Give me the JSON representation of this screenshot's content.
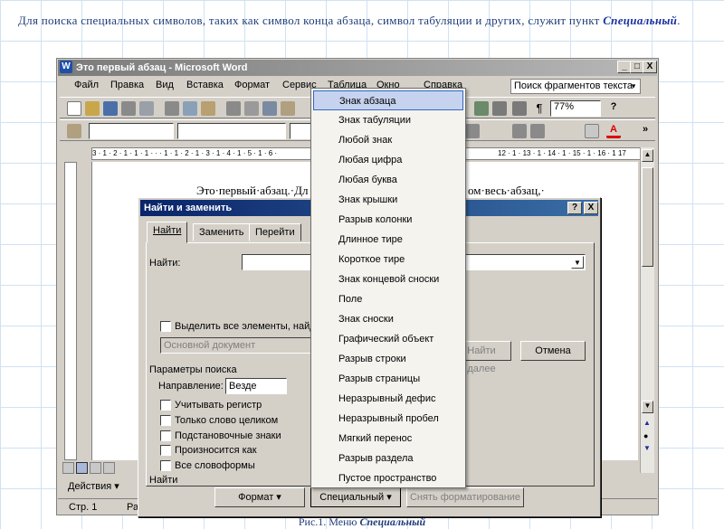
{
  "intro_text": "Для поиска специальных символов, таких как символ конца абзаца, символ табуляции и других, служит пункт",
  "intro_highlight": "Специальный",
  "intro_end": ".",
  "caption_prefix": "Рис.1. Меню",
  "caption_highlight": "Специальный",
  "window": {
    "title": "Это первый абзац - Microsoft Word",
    "app_icon": "W",
    "min_glyph": "_",
    "max_glyph": "□",
    "close_glyph": "X"
  },
  "menubar": {
    "items": [
      "Файл",
      "Правка",
      "Вид",
      "Вставка",
      "Формат",
      "Сервис",
      "Таблица",
      "Окно",
      "Справка"
    ],
    "search_text": "Поиск фрагментов текста",
    "dropdown_glyph": "▾"
  },
  "toolbar": {
    "zoom": "77%",
    "question": "?",
    "expand": "»"
  },
  "ruler_text": "3 · 1 · 2 · 1 · 1 · 1 · · · 1 · 1 · 2 · 1 · 3 · 1 · 4 · 1 · 5 · 1 · 6 ·",
  "ruler_right_text": "12 · 1 · 13 · 1 · 14 · 1 · 15 · 1 · 16 · 1 17",
  "doc_text_left": "Это·первый·абзац.·Дл",
  "doc_text_right": "ом·весь·абзац,·",
  "status": {
    "page": "Стр. 1",
    "section": "Ра",
    "actions": "Действия ▾"
  },
  "dialog": {
    "title": "Найти и заменить",
    "help_glyph": "?",
    "close_glyph": "X",
    "tabs": [
      "Найти",
      "Заменить",
      "Перейти"
    ],
    "find_label": "Найти:",
    "find_value": "",
    "highlight_label": "Выделить все элементы, найде",
    "main_doc": "Основной документ",
    "find_next": "Найти далее",
    "cancel": "Отмена",
    "search_params": "Параметры поиска",
    "direction_label": "Направление:",
    "direction_value": "Везде",
    "options": [
      "Учитывать регистр",
      "Только слово целиком",
      "Подстановочные знаки",
      "Произносится как",
      "Все словоформы"
    ],
    "find_group": "Найти",
    "format_btn": "Формат ▾",
    "special_btn": "Специальный ▾",
    "clear_format_btn": "Снять форматирование"
  },
  "special_menu": {
    "items": [
      "Знак абзаца",
      "Знак табуляции",
      "Любой знак",
      "Любая цифра",
      "Любая буква",
      "Знак крышки",
      "Разрыв колонки",
      "Длинное тире",
      "Короткое тире",
      "Знак концевой сноски",
      "Поле",
      "Знак сноски",
      "Графический объект",
      "Разрыв строки",
      "Разрыв страницы",
      "Неразрывный дефис",
      "Неразрывный пробел",
      "Мягкий перенос",
      "Разрыв раздела",
      "Пустое пространство"
    ],
    "selected": "Знак абзаца"
  },
  "colors": {
    "dialog_title_bg": "#0a246a",
    "menu_selection": "#c6d3ef",
    "text_blue": "#1f3d7a",
    "highlight_blue": "#1a2fa0"
  }
}
